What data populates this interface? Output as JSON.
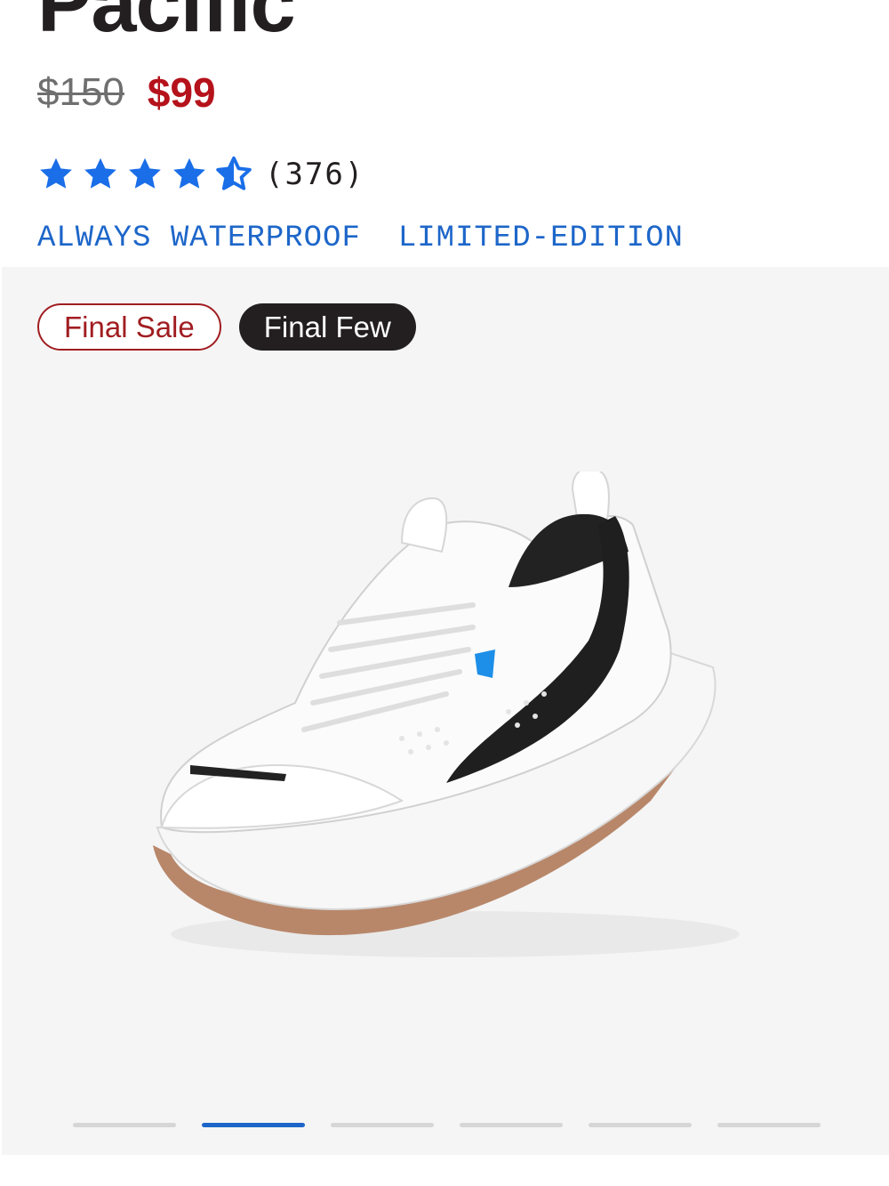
{
  "product": {
    "title": "Pacific",
    "price_original": "$150",
    "price_sale": "$99"
  },
  "rating": {
    "value": 4.5,
    "max": 5,
    "count": "(376)",
    "star_color": "#1a6ee8"
  },
  "tags": [
    "ALWAYS WATERPROOF",
    "LIMITED-EDITION"
  ],
  "gallery": {
    "badges": {
      "final_sale": "Final Sale",
      "final_few": "Final Few"
    },
    "image_icon": "white-black-sneaker",
    "slide_count": 6,
    "active_slide": 2
  },
  "colors": {
    "sale_price": "#b5121b",
    "tag_blue": "#1d66c9",
    "badge_dark": "#231f20",
    "badge_red": "#a11d21"
  }
}
